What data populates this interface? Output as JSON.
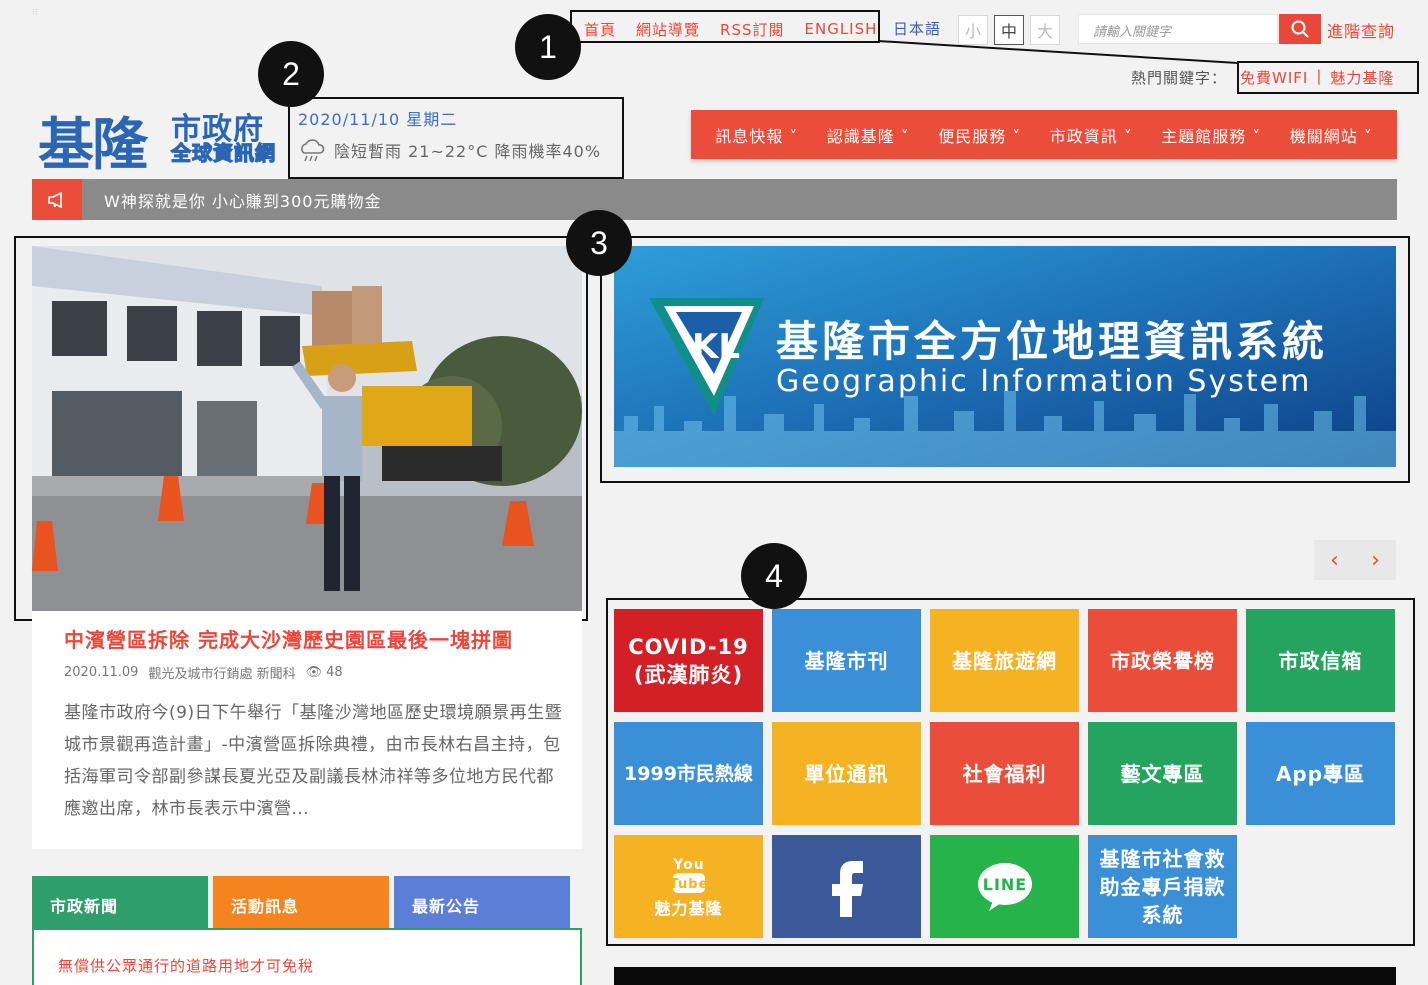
{
  "top_links": [
    "首頁",
    "網站導覽",
    "RSS訂閱",
    "ENGLISH"
  ],
  "jp_link": "日本語",
  "font_sizes": [
    "小",
    "中",
    "大"
  ],
  "search": {
    "placeholder": "請輸入關鍵字",
    "advanced_label": "進階查詢"
  },
  "hot": {
    "label": "熱門關鍵字：",
    "keywords": [
      "免費WIFI",
      "|",
      "魅力基隆"
    ]
  },
  "callouts": [
    "1",
    "2",
    "3",
    "4"
  ],
  "logo": {
    "main": "基隆",
    "sub1": "市政府",
    "sub2": "全球資訊網"
  },
  "date": "2020/11/10 星期二",
  "weather": "陰短暫雨 21~22°C 降雨機率40%",
  "nav": [
    "訊息快報 ˅",
    "認識基隆 ˅",
    "便民服務 ˅",
    "市政資訊 ˅",
    "主題館服務 ˅",
    "機關網站 ˅"
  ],
  "marquee": "W神探就是你 小心賺到300元購物金",
  "news": {
    "title": "中濱營區拆除 完成大沙灣歷史園區最後一塊拼圖",
    "date": "2020.11.09",
    "dept": "觀光及城市行銷處 新聞科",
    "views": "48",
    "body": "基隆市政府今(9)日下午舉行「基隆沙灣地區歷史環境願景再生暨城市景觀再造計畫」-中濱營區拆除典禮，由市長林右昌主持，包括海軍司令部副參謀長夏光亞及副議長林沛祥等多位地方民代都應邀出席，林市長表示中濱營..."
  },
  "tabs": [
    "市政新聞",
    "活動訊息",
    "最新公告"
  ],
  "tab_item": "無償供公眾通行的道路用地才可免稅",
  "gis": {
    "title": "基隆市全方位地理資訊系統",
    "subtitle": "Geographic Information System",
    "logo_text": "KL"
  },
  "arrows": [
    "‹",
    "›"
  ],
  "tiles": [
    {
      "label": "COVID-19\n(武漢肺炎)",
      "color": "#d32026"
    },
    {
      "label": "基隆市刊",
      "color": "#3a8fd6"
    },
    {
      "label": "基隆旅遊網",
      "color": "#f5b323"
    },
    {
      "label": "市政榮譽榜",
      "color": "#ea4d3a"
    },
    {
      "label": "市政信箱",
      "color": "#25a45f"
    },
    {
      "label": "1999市民熱線",
      "color": "#3a8fd6"
    },
    {
      "label": "單位通訊",
      "color": "#f5b323"
    },
    {
      "label": "社會福利",
      "color": "#ea4d3a"
    },
    {
      "label": "藝文專區",
      "color": "#25a45f"
    },
    {
      "label": "App專區",
      "color": "#3a8fd6"
    },
    {
      "label": "魅力基隆",
      "color": "#f5b323",
      "icon": "youtube"
    },
    {
      "label": "",
      "color": "#3b5998",
      "icon": "facebook"
    },
    {
      "label": "",
      "color": "#25b34a",
      "icon": "line"
    },
    {
      "label": "基隆市社會救助金專戶捐款系統",
      "color": "#3a8fd6"
    }
  ],
  "youtube_text": [
    "You",
    "Tube"
  ],
  "line_text": "LINE",
  "colors": {
    "accent": "#e8473a",
    "brand_blue": "#2b66b4",
    "tab_green": "#2e9e6a",
    "tab_orange": "#f5831f",
    "tab_blue": "#5b7fd6"
  }
}
